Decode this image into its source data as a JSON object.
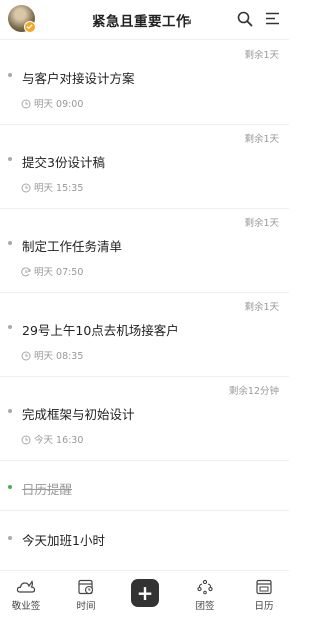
{
  "header": {
    "title": "紧急且重要工作"
  },
  "tasks": [
    {
      "remaining": "剩余1天",
      "title": "与客户对接设计方案",
      "time": "明天 09:00",
      "time_icon": "clock-icon"
    },
    {
      "remaining": "剩余1天",
      "title": "提交3份设计稿",
      "time": "明天 15:35",
      "time_icon": "clock-icon"
    },
    {
      "remaining": "剩余1天",
      "title": "制定工作任务清单",
      "time": "明天 07:50",
      "time_icon": "repeat-clock-icon"
    },
    {
      "remaining": "剩余1天",
      "title": "29号上午10点去机场接客户",
      "time": "明天 08:35",
      "time_icon": "clock-icon"
    },
    {
      "remaining": "剩余12分钟",
      "title": "完成框架与初始设计",
      "time": "今天 16:30",
      "time_icon": "clock-icon"
    }
  ],
  "calendar_reminder": {
    "title": "日历提醒"
  },
  "last_task": {
    "title": "今天加班1小时"
  },
  "bottom_nav": {
    "items": [
      {
        "label": "敬业签",
        "icon": "cloud-note-icon"
      },
      {
        "label": "时间",
        "icon": "calendar-clock-icon"
      },
      {
        "label": "团签",
        "icon": "team-icon"
      },
      {
        "label": "日历",
        "icon": "calendar-icon"
      }
    ],
    "add_label": "+"
  },
  "colors": {
    "accent_badge": "#f5a623",
    "completed_dot": "#4caf50",
    "add_button_bg": "#333333",
    "secondary_text": "#999999"
  }
}
